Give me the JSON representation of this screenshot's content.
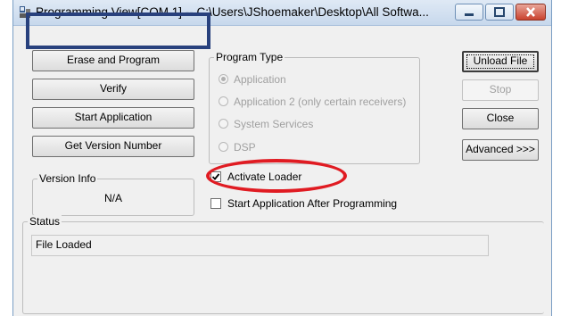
{
  "window": {
    "title": "Programming View[COM 1] -- C:\\Users\\JShoemaker\\Desktop\\All Softwa..."
  },
  "actions": {
    "erase_program": "Erase and Program",
    "verify": "Verify",
    "start_application": "Start Application",
    "get_version": "Get Version Number"
  },
  "program_type": {
    "label": "Program Type",
    "options": [
      "Application",
      "Application 2 (only certain receivers)",
      "System Services",
      "DSP"
    ],
    "selected": "Application"
  },
  "side_buttons": {
    "unload_file": "Unload File",
    "stop": "Stop",
    "close": "Close",
    "advanced": "Advanced >>>"
  },
  "version_info": {
    "label": "Version Info",
    "value": "N/A"
  },
  "options": {
    "activate_loader": "Activate Loader",
    "activate_loader_checked": true,
    "start_after_programming": "Start Application After Programming",
    "start_after_programming_checked": false
  },
  "status": {
    "label": "Status",
    "text": "File Loaded"
  },
  "colors": {
    "highlight_rect": "#28417d",
    "highlight_ellipse": "#e01b22"
  }
}
